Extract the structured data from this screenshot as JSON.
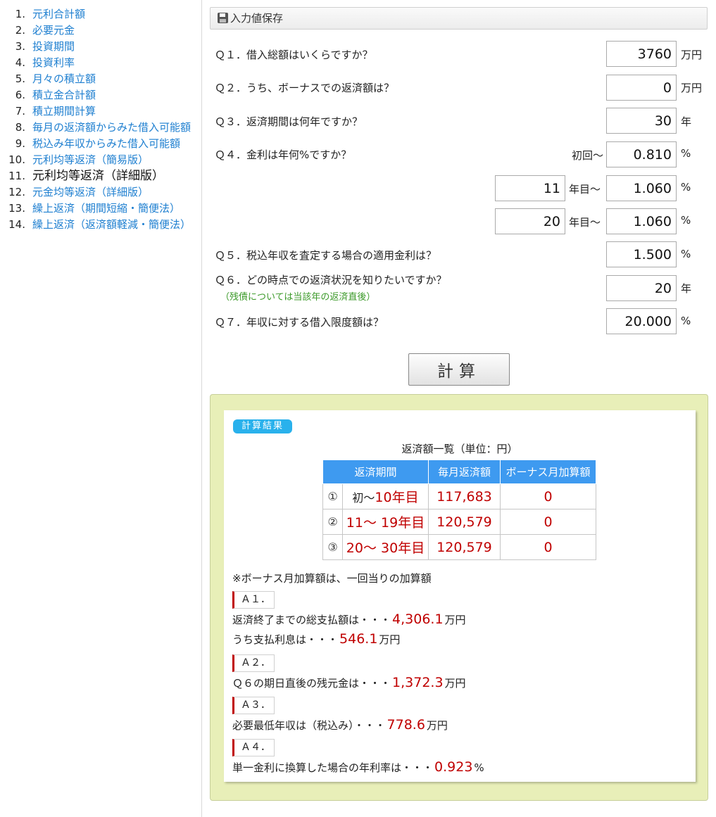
{
  "sidebar": {
    "items": [
      {
        "num": "1.",
        "label": "元利合計額"
      },
      {
        "num": "2.",
        "label": "必要元金"
      },
      {
        "num": "3.",
        "label": "投資期間"
      },
      {
        "num": "4.",
        "label": "投資利率"
      },
      {
        "num": "5.",
        "label": "月々の積立額"
      },
      {
        "num": "6.",
        "label": "積立金合計額"
      },
      {
        "num": "7.",
        "label": "積立期間計算"
      },
      {
        "num": "8.",
        "label": "毎月の返済額からみた借入可能額"
      },
      {
        "num": "9.",
        "label": "税込み年収からみた借入可能額"
      },
      {
        "num": "10.",
        "label": "元利均等返済（簡易版）"
      },
      {
        "num": "11.",
        "label": "元利均等返済（詳細版）"
      },
      {
        "num": "12.",
        "label": "元金均等返済（詳細版）"
      },
      {
        "num": "13.",
        "label": "繰上返済（期間短縮・簡便法）"
      },
      {
        "num": "14.",
        "label": "繰上返済（返済額軽減・簡便法）"
      }
    ]
  },
  "save_label": "入力値保存",
  "form": {
    "q1": {
      "label": "Ｑ１．借入総額はいくらですか？",
      "value": "3760",
      "unit": "万円"
    },
    "q2": {
      "label": "Ｑ２．うち、ボーナスでの返済額は？",
      "value": "0",
      "unit": "万円"
    },
    "q3": {
      "label": "Ｑ３．返済期間は何年ですか？",
      "value": "30",
      "unit": "年"
    },
    "q4": {
      "label": "Ｑ４．金利は年何%ですか？",
      "first_label": "初回～",
      "rate1": "0.810",
      "year2": "11",
      "rate2": "1.060",
      "year3": "20",
      "rate3": "1.060",
      "year_unit": "年目～",
      "unit": "%"
    },
    "q5": {
      "label": "Ｑ５．税込年収を査定する場合の適用金利は？",
      "value": "1.500",
      "unit": "%"
    },
    "q6": {
      "label": "Ｑ６．どの時点での返済状況を知りたいですか？",
      "note": "（残債については当該年の返済直後）",
      "value": "20",
      "unit": "年"
    },
    "q7": {
      "label": "Ｑ７．年収に対する借入限度額は？",
      "value": "20.000",
      "unit": "%"
    }
  },
  "calc_button": "計算",
  "result": {
    "tag": "計算結果",
    "caption": "返済額一覧（単位：円）",
    "headers": [
      "返済期間",
      "毎月返済額",
      "ボーナス月加算額"
    ],
    "rows": [
      {
        "mark": "①",
        "from": "初～",
        "to": "10年目",
        "monthly": "117,683",
        "bonus": "0"
      },
      {
        "mark": "②",
        "from": "11～",
        "to": "19年目",
        "monthly": "120,579",
        "bonus": "0"
      },
      {
        "mark": "③",
        "from": "20～",
        "to": "30年目",
        "monthly": "120,579",
        "bonus": "0"
      }
    ],
    "bonus_note": "※ボーナス月加算額は、一回当りの加算額",
    "a1": {
      "label": "Ａ１．",
      "line1_text": "返済終了までの総支払額は・・・",
      "line1_value": "4,306.1",
      "line1_unit": "万円",
      "line2_text": "うち支払利息は・・・",
      "line2_value": "546.1",
      "line2_unit": "万円"
    },
    "a2": {
      "label": "Ａ２．",
      "text": "Ｑ６の期日直後の残元金は・・・",
      "value": "1,372.3",
      "unit": "万円"
    },
    "a3": {
      "label": "Ａ３．",
      "text": "必要最低年収は（税込み）・・・",
      "value": "778.6",
      "unit": "万円"
    },
    "a4": {
      "label": "Ａ４．",
      "text": "単一金利に換算した場合の年利率は・・・",
      "value": "0.923",
      "unit": "%"
    }
  }
}
